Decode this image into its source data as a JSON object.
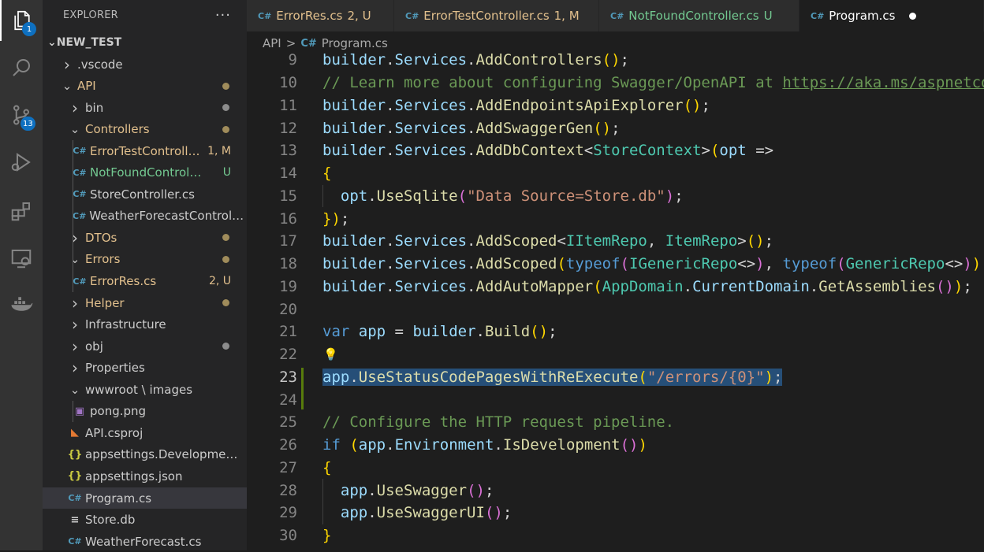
{
  "activity_bar": {
    "items": [
      {
        "name": "explorer-icon",
        "badge": "1"
      },
      {
        "name": "search-icon",
        "badge": ""
      },
      {
        "name": "source-control-icon",
        "badge": "13"
      },
      {
        "name": "run-debug-icon",
        "badge": ""
      },
      {
        "name": "extensions-icon",
        "badge": ""
      },
      {
        "name": "remote-explorer-icon",
        "badge": ""
      },
      {
        "name": "docker-icon",
        "badge": ""
      }
    ]
  },
  "sidebar": {
    "title": "EXPLORER",
    "more": "···",
    "root": "NEW_TEST",
    "rows": [
      {
        "label": ".vscode",
        "type": "folder-collapsed",
        "depth": 1,
        "color": "#cccccc",
        "deco": "",
        "dot": ""
      },
      {
        "label": "API",
        "type": "folder-open",
        "depth": 1,
        "color": "#e2c08d",
        "deco": "",
        "dot": "#a08c5b"
      },
      {
        "label": "bin",
        "type": "folder-collapsed",
        "depth": 2,
        "color": "#cccccc",
        "deco": "",
        "dot": "#8c8c8c"
      },
      {
        "label": "Controllers",
        "type": "folder-open",
        "depth": 2,
        "color": "#e2c08d",
        "deco": "",
        "dot": "#a08c5b"
      },
      {
        "label": "ErrorTestController.cs",
        "type": "cs",
        "depth": 3,
        "color": "#e2c08d",
        "deco": "1, M",
        "decoColor": "#e2c08d"
      },
      {
        "label": "NotFoundController.cs",
        "type": "cs",
        "depth": 3,
        "color": "#73c991",
        "deco": "U",
        "decoColor": "#73c991"
      },
      {
        "label": "StoreController.cs",
        "type": "cs",
        "depth": 3,
        "color": "#cccccc",
        "deco": ""
      },
      {
        "label": "WeatherForecastController.cs",
        "type": "cs",
        "depth": 3,
        "color": "#cccccc",
        "deco": ""
      },
      {
        "label": "DTOs",
        "type": "folder-collapsed",
        "depth": 2,
        "color": "#e2c08d",
        "deco": "",
        "dot": "#a08c5b"
      },
      {
        "label": "Errors",
        "type": "folder-open",
        "depth": 2,
        "color": "#e2c08d",
        "deco": "",
        "dot": "#a08c5b"
      },
      {
        "label": "ErrorRes.cs",
        "type": "cs",
        "depth": 3,
        "color": "#e2c08d",
        "deco": "2, U",
        "decoColor": "#e2c08d"
      },
      {
        "label": "Helper",
        "type": "folder-collapsed",
        "depth": 2,
        "color": "#e2c08d",
        "deco": "",
        "dot": "#a08c5b"
      },
      {
        "label": "Infrastructure",
        "type": "folder-collapsed",
        "depth": 2,
        "color": "#cccccc",
        "deco": ""
      },
      {
        "label": "obj",
        "type": "folder-collapsed",
        "depth": 2,
        "color": "#cccccc",
        "deco": "",
        "dot": "#8c8c8c"
      },
      {
        "label": "Properties",
        "type": "folder-collapsed",
        "depth": 2,
        "color": "#cccccc",
        "deco": ""
      },
      {
        "label": "wwwroot \\ images",
        "type": "folder-open",
        "depth": 2,
        "color": "#cccccc",
        "deco": ""
      },
      {
        "label": "pong.png",
        "type": "png",
        "depth": 3,
        "color": "#cccccc",
        "deco": ""
      },
      {
        "label": "API.csproj",
        "type": "rss",
        "depth": 2,
        "color": "#cccccc",
        "deco": ""
      },
      {
        "label": "appsettings.Development.json",
        "type": "json",
        "depth": 2,
        "color": "#cccccc",
        "deco": ""
      },
      {
        "label": "appsettings.json",
        "type": "json",
        "depth": 2,
        "color": "#cccccc",
        "deco": ""
      },
      {
        "label": "Program.cs",
        "type": "cs",
        "depth": 2,
        "color": "#cccccc",
        "deco": "",
        "selected": true
      },
      {
        "label": "Store.db",
        "type": "db",
        "depth": 2,
        "color": "#cccccc",
        "deco": ""
      },
      {
        "label": "WeatherForecast.cs",
        "type": "cs",
        "depth": 2,
        "color": "#cccccc",
        "deco": ""
      }
    ]
  },
  "tabs": [
    {
      "label": "ErrorRes.cs",
      "deco": "2, U",
      "color": "#e2c08d",
      "decoColor": "#e2c08d",
      "active": false
    },
    {
      "label": "ErrorTestController.cs",
      "deco": "1, M",
      "color": "#e2c08d",
      "decoColor": "#e2c08d",
      "active": false
    },
    {
      "label": "NotFoundController.cs",
      "deco": "U",
      "color": "#73c991",
      "decoColor": "#73c991",
      "active": false
    },
    {
      "label": "Program.cs",
      "deco": "",
      "color": "#ffffff",
      "decoColor": "#ffffff",
      "active": true,
      "dirty": true
    }
  ],
  "breadcrumb": {
    "folder": "API",
    "file": "Program.cs",
    "sep": ">"
  },
  "editor": {
    "current_line": 23,
    "lines": [
      {
        "n": "9",
        "tokens": [
          [
            "id",
            "builder"
          ],
          [
            "pl",
            "."
          ],
          [
            "id",
            "Services"
          ],
          [
            "pl",
            "."
          ],
          [
            "fn",
            "AddControllers"
          ],
          [
            "b1",
            "()"
          ],
          [
            "pl",
            ";"
          ]
        ]
      },
      {
        "n": "10",
        "tokens": [
          [
            "cm",
            "// Learn more about configuring Swagger/OpenAPI at "
          ],
          [
            "lnk",
            "https://aka.ms/aspnetcore/swashbuckle"
          ]
        ]
      },
      {
        "n": "11",
        "tokens": [
          [
            "id",
            "builder"
          ],
          [
            "pl",
            "."
          ],
          [
            "id",
            "Services"
          ],
          [
            "pl",
            "."
          ],
          [
            "fn",
            "AddEndpointsApiExplorer"
          ],
          [
            "b1",
            "()"
          ],
          [
            "pl",
            ";"
          ]
        ]
      },
      {
        "n": "12",
        "tokens": [
          [
            "id",
            "builder"
          ],
          [
            "pl",
            "."
          ],
          [
            "id",
            "Services"
          ],
          [
            "pl",
            "."
          ],
          [
            "fn",
            "AddSwaggerGen"
          ],
          [
            "b1",
            "()"
          ],
          [
            "pl",
            ";"
          ]
        ]
      },
      {
        "n": "13",
        "tokens": [
          [
            "id",
            "builder"
          ],
          [
            "pl",
            "."
          ],
          [
            "id",
            "Services"
          ],
          [
            "pl",
            "."
          ],
          [
            "fn",
            "AddDbContext"
          ],
          [
            "pl",
            "<"
          ],
          [
            "ty",
            "StoreContext"
          ],
          [
            "pl",
            ">"
          ],
          [
            "b1",
            "("
          ],
          [
            "id",
            "opt"
          ],
          [
            "pl",
            " =>"
          ]
        ]
      },
      {
        "n": "14",
        "tokens": [
          [
            "b1",
            "{"
          ]
        ]
      },
      {
        "n": "15",
        "tokens": [
          [
            "pl",
            "  "
          ],
          [
            "id",
            "opt"
          ],
          [
            "pl",
            "."
          ],
          [
            "fn",
            "UseSqlite"
          ],
          [
            "b2",
            "("
          ],
          [
            "st",
            "\"Data Source=Store.db\""
          ],
          [
            "b2",
            ")"
          ],
          [
            "pl",
            ";"
          ]
        ]
      },
      {
        "n": "16",
        "tokens": [
          [
            "b1",
            "})"
          ],
          [
            "pl",
            ";"
          ]
        ]
      },
      {
        "n": "17",
        "tokens": [
          [
            "id",
            "builder"
          ],
          [
            "pl",
            "."
          ],
          [
            "id",
            "Services"
          ],
          [
            "pl",
            "."
          ],
          [
            "fn",
            "AddScoped"
          ],
          [
            "pl",
            "<"
          ],
          [
            "ty",
            "IItemRepo"
          ],
          [
            "pl",
            ", "
          ],
          [
            "ty",
            "ItemRepo"
          ],
          [
            "pl",
            ">"
          ],
          [
            "b1",
            "()"
          ],
          [
            "pl",
            ";"
          ]
        ]
      },
      {
        "n": "18",
        "tokens": [
          [
            "id",
            "builder"
          ],
          [
            "pl",
            "."
          ],
          [
            "id",
            "Services"
          ],
          [
            "pl",
            "."
          ],
          [
            "fn",
            "AddScoped"
          ],
          [
            "b1",
            "("
          ],
          [
            "kw",
            "typeof"
          ],
          [
            "b2",
            "("
          ],
          [
            "ty",
            "IGenericRepo"
          ],
          [
            "pl",
            "<>"
          ],
          [
            "b2",
            ")"
          ],
          [
            "pl",
            ", "
          ],
          [
            "kw",
            "typeof"
          ],
          [
            "b2",
            "("
          ],
          [
            "ty",
            "GenericRepo"
          ],
          [
            "pl",
            "<>"
          ],
          [
            "b2",
            ")"
          ],
          [
            "b1",
            ")"
          ],
          [
            "pl",
            ";"
          ]
        ]
      },
      {
        "n": "19",
        "tokens": [
          [
            "id",
            "builder"
          ],
          [
            "pl",
            "."
          ],
          [
            "id",
            "Services"
          ],
          [
            "pl",
            "."
          ],
          [
            "fn",
            "AddAutoMapper"
          ],
          [
            "b1",
            "("
          ],
          [
            "ty",
            "AppDomain"
          ],
          [
            "pl",
            "."
          ],
          [
            "id",
            "CurrentDomain"
          ],
          [
            "pl",
            "."
          ],
          [
            "fn",
            "GetAssemblies"
          ],
          [
            "b2",
            "()"
          ],
          [
            "b1",
            ")"
          ],
          [
            "pl",
            ";"
          ]
        ]
      },
      {
        "n": "20",
        "tokens": []
      },
      {
        "n": "21",
        "tokens": [
          [
            "kw",
            "var"
          ],
          [
            "pl",
            " "
          ],
          [
            "id",
            "app"
          ],
          [
            "pl",
            " = "
          ],
          [
            "id",
            "builder"
          ],
          [
            "pl",
            "."
          ],
          [
            "fn",
            "Build"
          ],
          [
            "b1",
            "()"
          ],
          [
            "pl",
            ";"
          ]
        ]
      },
      {
        "n": "22",
        "tokens": [],
        "bulb": true
      },
      {
        "n": "23",
        "tokens": [
          [
            "id",
            "app"
          ],
          [
            "pl",
            "."
          ],
          [
            "fn",
            "UseStatusCodePagesWithReExecute"
          ],
          [
            "b1",
            "("
          ],
          [
            "st",
            "\"/errors/{0}\""
          ],
          [
            "b1",
            ")"
          ],
          [
            "pl",
            ";"
          ]
        ],
        "selected": true
      },
      {
        "n": "24",
        "tokens": []
      },
      {
        "n": "25",
        "tokens": [
          [
            "cm",
            "// Configure the HTTP request pipeline."
          ]
        ]
      },
      {
        "n": "26",
        "tokens": [
          [
            "kw",
            "if"
          ],
          [
            "pl",
            " "
          ],
          [
            "b1",
            "("
          ],
          [
            "id",
            "app"
          ],
          [
            "pl",
            "."
          ],
          [
            "id",
            "Environment"
          ],
          [
            "pl",
            "."
          ],
          [
            "fn",
            "IsDevelopment"
          ],
          [
            "b2",
            "()"
          ],
          [
            "b1",
            ")"
          ]
        ]
      },
      {
        "n": "27",
        "tokens": [
          [
            "b1",
            "{"
          ]
        ]
      },
      {
        "n": "28",
        "tokens": [
          [
            "pl",
            "  "
          ],
          [
            "id",
            "app"
          ],
          [
            "pl",
            "."
          ],
          [
            "fn",
            "UseSwagger"
          ],
          [
            "b2",
            "()"
          ],
          [
            "pl",
            ";"
          ]
        ]
      },
      {
        "n": "29",
        "tokens": [
          [
            "pl",
            "  "
          ],
          [
            "id",
            "app"
          ],
          [
            "pl",
            "."
          ],
          [
            "fn",
            "UseSwaggerUI"
          ],
          [
            "b2",
            "()"
          ],
          [
            "pl",
            ";"
          ]
        ]
      },
      {
        "n": "30",
        "tokens": [
          [
            "b1",
            "}"
          ]
        ]
      }
    ]
  }
}
